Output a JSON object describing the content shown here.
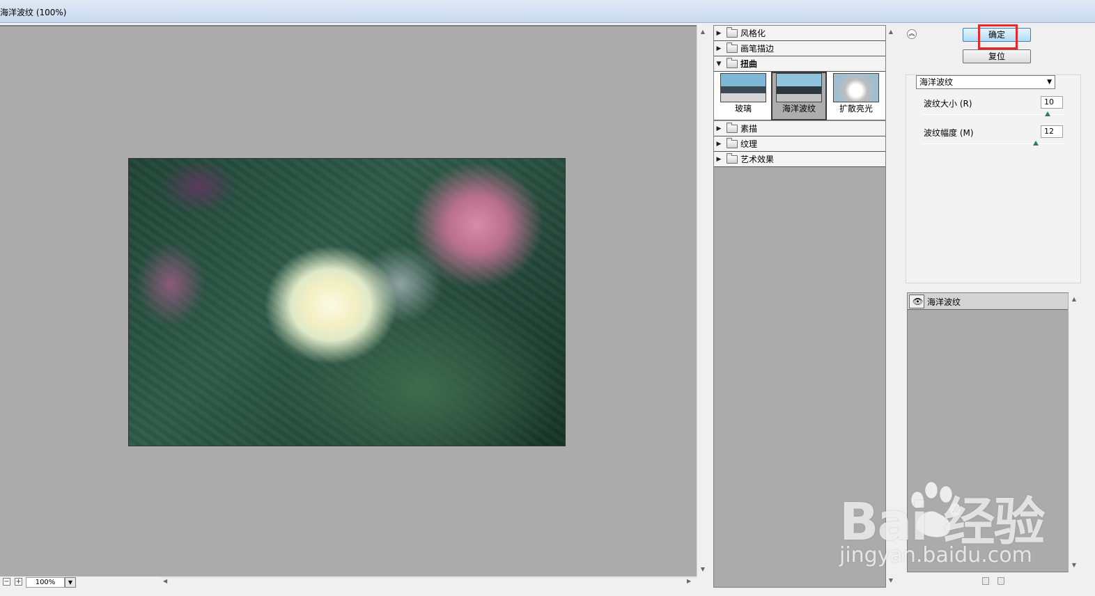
{
  "window": {
    "title": "海洋波纹 (100%)"
  },
  "preview": {
    "zoom": "100%"
  },
  "gallery": {
    "categories_top": [
      {
        "label": "风格化",
        "expanded": false
      },
      {
        "label": "画笔描边",
        "expanded": false
      },
      {
        "label": "扭曲",
        "expanded": true
      }
    ],
    "thumbnails": [
      {
        "label": "玻璃",
        "selected": false
      },
      {
        "label": "海洋波纹",
        "selected": true
      },
      {
        "label": "扩散亮光",
        "selected": false
      }
    ],
    "categories_bottom": [
      {
        "label": "素描"
      },
      {
        "label": "纹理"
      },
      {
        "label": "艺术效果"
      }
    ]
  },
  "buttons": {
    "ok_label": "确定",
    "reset_label": "复位",
    "highlight_color": "#e8262c"
  },
  "settings": {
    "filter": "海洋波纹",
    "ripple_size": {
      "label": "波纹大小 (R)",
      "value": "10",
      "fraction": 0.88
    },
    "ripple_magnitude": {
      "label": "波纹幅度 (M)",
      "value": "12",
      "fraction": 0.8
    }
  },
  "layers": {
    "items": [
      {
        "label": "海洋波纹"
      }
    ]
  },
  "watermark": {
    "brand": "Bai 经验",
    "url": "jingyan.baidu.com"
  }
}
